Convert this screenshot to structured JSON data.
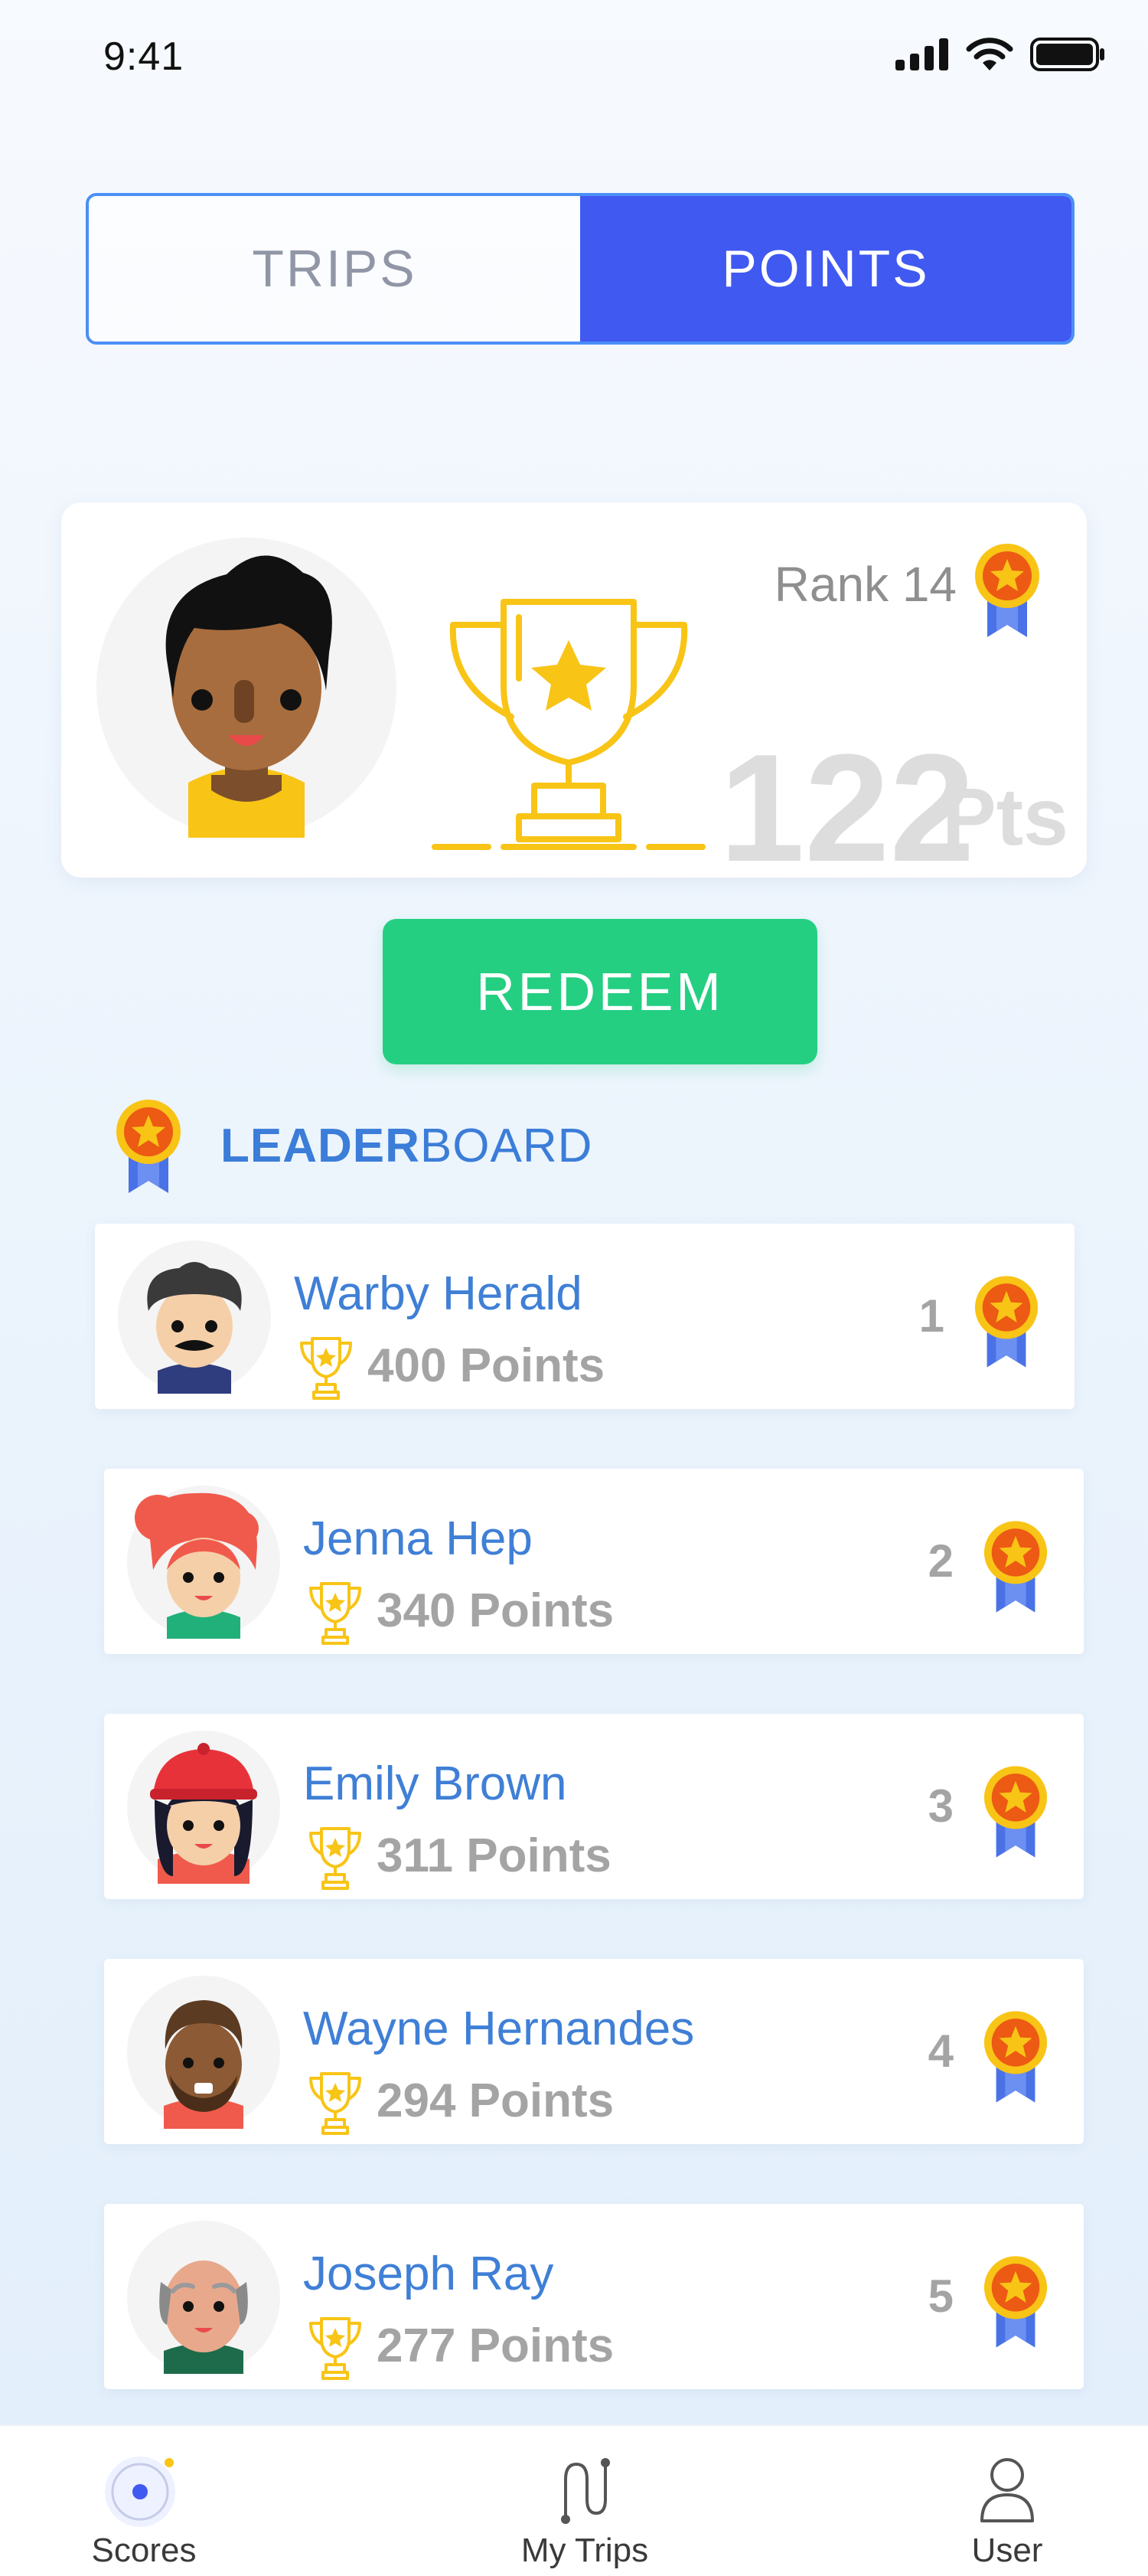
{
  "status_bar": {
    "time": "9:41"
  },
  "segmented": {
    "trips_label": "TRIPS",
    "points_label": "POINTS",
    "active": "POINTS"
  },
  "profile": {
    "rank_label": "Rank 14",
    "points_value": "122",
    "points_unit": "Pts"
  },
  "redeem_label": "REDEEM",
  "leaderboard": {
    "title_bold": "LEADER",
    "title_rest": "BOARD",
    "entries": [
      {
        "rank": "1",
        "name": "Warby Herald",
        "points": "400 Points",
        "avatar": "man-mustache-avatar"
      },
      {
        "rank": "2",
        "name": "Jenna Hep",
        "points": "340 Points",
        "avatar": "woman-red-hair-avatar"
      },
      {
        "rank": "3",
        "name": "Emily Brown",
        "points": "311 Points",
        "avatar": "woman-red-cap-avatar"
      },
      {
        "rank": "4",
        "name": "Wayne Hernandes",
        "points": "294 Points",
        "avatar": "man-beard-avatar"
      },
      {
        "rank": "5",
        "name": "Joseph Ray",
        "points": "277 Points",
        "avatar": "old-man-avatar"
      }
    ]
  },
  "tab_bar": {
    "scores": "Scores",
    "my_trips": "My Trips",
    "user": "User",
    "active": "Scores"
  },
  "colors": {
    "accent_blue": "#4059f1",
    "link_blue": "#3f7fd6",
    "redeem_green": "#24cf82",
    "trophy_gold": "#f8c416",
    "medal_orange": "#ec5a14"
  }
}
